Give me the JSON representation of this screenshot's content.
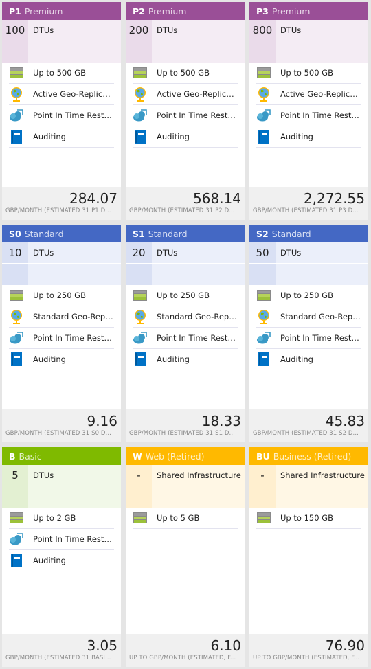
{
  "tiers": [
    {
      "code": "P1",
      "name": "Premium",
      "theme": "premium",
      "spec_value": "100",
      "spec_label": "DTUs",
      "features": [
        {
          "icon": "storage-icon",
          "text": "Up to 500 GB"
        },
        {
          "icon": "globe-icon",
          "text": "Active Geo-Replicat..."
        },
        {
          "icon": "cloud-restore-icon",
          "text": "Point In Time Resto..."
        },
        {
          "icon": "book-icon",
          "text": "Auditing"
        }
      ],
      "price": "284.07",
      "note": "GBP/MONTH (ESTIMATED 31 P1 D..."
    },
    {
      "code": "P2",
      "name": "Premium",
      "theme": "premium",
      "spec_value": "200",
      "spec_label": "DTUs",
      "features": [
        {
          "icon": "storage-icon",
          "text": "Up to 500 GB"
        },
        {
          "icon": "globe-icon",
          "text": "Active Geo-Replicat..."
        },
        {
          "icon": "cloud-restore-icon",
          "text": "Point In Time Resto..."
        },
        {
          "icon": "book-icon",
          "text": "Auditing"
        }
      ],
      "price": "568.14",
      "note": "GBP/MONTH (ESTIMATED 31 P2 D..."
    },
    {
      "code": "P3",
      "name": "Premium",
      "theme": "premium",
      "spec_value": "800",
      "spec_label": "DTUs",
      "features": [
        {
          "icon": "storage-icon",
          "text": "Up to 500 GB"
        },
        {
          "icon": "globe-icon",
          "text": "Active Geo-Replicat..."
        },
        {
          "icon": "cloud-restore-icon",
          "text": "Point In Time Resto..."
        },
        {
          "icon": "book-icon",
          "text": "Auditing"
        }
      ],
      "price": "2,272.55",
      "note": "GBP/MONTH (ESTIMATED 31 P3 D..."
    },
    {
      "code": "S0",
      "name": "Standard",
      "theme": "standard",
      "spec_value": "10",
      "spec_label": "DTUs",
      "features": [
        {
          "icon": "storage-icon",
          "text": "Up to 250 GB"
        },
        {
          "icon": "globe-icon",
          "text": "Standard Geo-Repli..."
        },
        {
          "icon": "cloud-restore-icon",
          "text": "Point In Time Resto..."
        },
        {
          "icon": "book-icon",
          "text": "Auditing"
        }
      ],
      "price": "9.16",
      "note": "GBP/MONTH (ESTIMATED 31 S0 D..."
    },
    {
      "code": "S1",
      "name": "Standard",
      "theme": "standard",
      "spec_value": "20",
      "spec_label": "DTUs",
      "features": [
        {
          "icon": "storage-icon",
          "text": "Up to 250 GB"
        },
        {
          "icon": "globe-icon",
          "text": "Standard Geo-Repli..."
        },
        {
          "icon": "cloud-restore-icon",
          "text": "Point In Time Resto..."
        },
        {
          "icon": "book-icon",
          "text": "Auditing"
        }
      ],
      "price": "18.33",
      "note": "GBP/MONTH (ESTIMATED 31 S1 D..."
    },
    {
      "code": "S2",
      "name": "Standard",
      "theme": "standard",
      "spec_value": "50",
      "spec_label": "DTUs",
      "features": [
        {
          "icon": "storage-icon",
          "text": "Up to 250 GB"
        },
        {
          "icon": "globe-icon",
          "text": "Standard Geo-Repli..."
        },
        {
          "icon": "cloud-restore-icon",
          "text": "Point In Time Resto..."
        },
        {
          "icon": "book-icon",
          "text": "Auditing"
        }
      ],
      "price": "45.83",
      "note": "GBP/MONTH (ESTIMATED 31 S2 D..."
    },
    {
      "code": "B",
      "name": "Basic",
      "theme": "basic",
      "spec_value": "5",
      "spec_label": "DTUs",
      "features": [
        {
          "icon": "storage-icon",
          "text": "Up to 2 GB"
        },
        {
          "icon": "cloud-restore-icon",
          "text": "Point In Time Resto..."
        },
        {
          "icon": "book-icon",
          "text": "Auditing"
        }
      ],
      "price": "3.05",
      "note": "GBP/MONTH (ESTIMATED 31 BASI..."
    },
    {
      "code": "W",
      "name": "Web (Retired)",
      "theme": "retired",
      "spec_value": "-",
      "spec_label": "Shared Infrastructure",
      "features": [
        {
          "icon": "storage-icon",
          "text": "Up to 5 GB"
        }
      ],
      "price": "6.10",
      "note": "UP TO GBP/MONTH (ESTIMATED, F..."
    },
    {
      "code": "BU",
      "name": "Business (Retired)",
      "theme": "retired",
      "spec_value": "-",
      "spec_label": "Shared Infrastructure",
      "features": [
        {
          "icon": "storage-icon",
          "text": "Up to 150 GB"
        }
      ],
      "price": "76.90",
      "note": "UP TO GBP/MONTH (ESTIMATED, F..."
    }
  ],
  "colors": {
    "premium": "#9a4f97",
    "standard": "#4468c4",
    "basic": "#7fba00",
    "retired": "#ffb900"
  }
}
